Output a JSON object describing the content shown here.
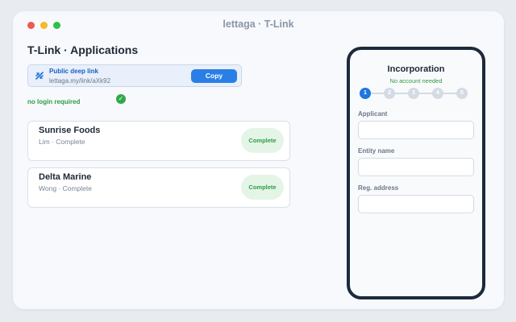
{
  "window": {
    "title": "lettaga · T-Link"
  },
  "page": {
    "title": "T-Link · Applications"
  },
  "deep_link": {
    "label": "Public deep link",
    "url": "lettaga.my/link/aXk92",
    "copy_label": "Copy",
    "icon": "link-icon"
  },
  "notice": {
    "text": "no login required",
    "icon": "check-circle-icon"
  },
  "applications": [
    {
      "name": "Sunrise Foods",
      "subtitle": "Lim · Complete",
      "status": "Complete"
    },
    {
      "name": "Delta Marine",
      "subtitle": "Wong · Complete",
      "status": "Complete"
    }
  ],
  "phone": {
    "title": "Incorporation",
    "subtitle": "No account needed",
    "steps": [
      "1",
      "2",
      "3",
      "4",
      "5"
    ],
    "active_step": 1,
    "fields": [
      {
        "label": "Applicant",
        "value": ""
      },
      {
        "label": "Entity name",
        "value": ""
      },
      {
        "label": "Reg. address",
        "value": ""
      }
    ]
  },
  "colors": {
    "accent": "#2a7fe6",
    "success": "#2f9c43",
    "phone_frame": "#1c2a3c"
  }
}
